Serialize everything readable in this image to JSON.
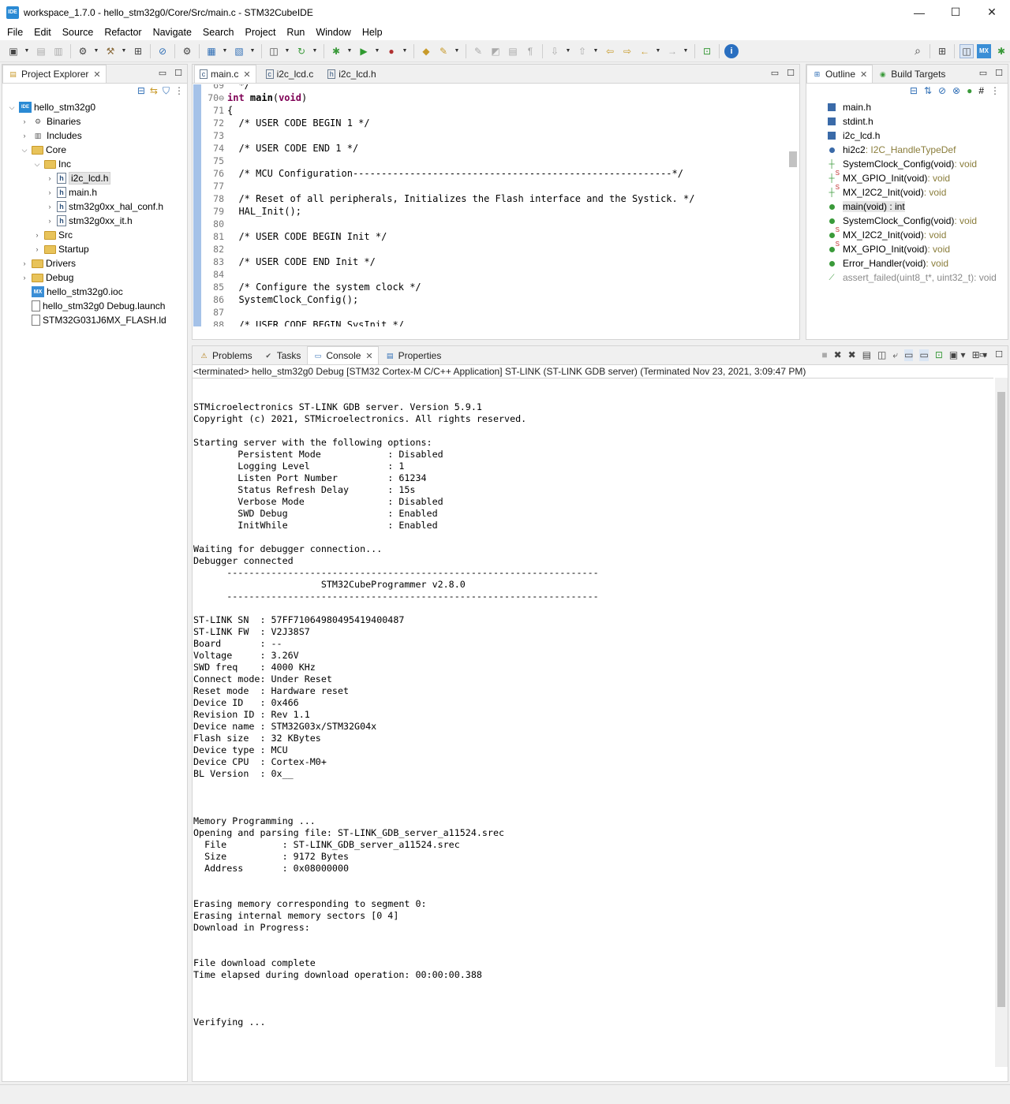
{
  "window": {
    "title": "workspace_1.7.0 - hello_stm32g0/Core/Src/main.c - STM32CubeIDE",
    "app_icon": "IDE",
    "minimize": "—",
    "maximize": "☐",
    "close": "✕"
  },
  "menu": [
    "File",
    "Edit",
    "Source",
    "Refactor",
    "Navigate",
    "Search",
    "Project",
    "Run",
    "Window",
    "Help"
  ],
  "explorer": {
    "tab_label": "Project Explorer",
    "tree": [
      {
        "label": "hello_stm32g0",
        "indent": 0,
        "arrow": "v",
        "icon": "proj"
      },
      {
        "label": "Binaries",
        "indent": 1,
        "arrow": ">",
        "icon": "bin"
      },
      {
        "label": "Includes",
        "indent": 1,
        "arrow": ">",
        "icon": "inc"
      },
      {
        "label": "Core",
        "indent": 1,
        "arrow": "v",
        "icon": "folder"
      },
      {
        "label": "Inc",
        "indent": 2,
        "arrow": "v",
        "icon": "folder"
      },
      {
        "label": "i2c_lcd.h",
        "indent": 3,
        "arrow": ">",
        "icon": "hfile",
        "selected": true
      },
      {
        "label": "main.h",
        "indent": 3,
        "arrow": ">",
        "icon": "hfile"
      },
      {
        "label": "stm32g0xx_hal_conf.h",
        "indent": 3,
        "arrow": ">",
        "icon": "hfile"
      },
      {
        "label": "stm32g0xx_it.h",
        "indent": 3,
        "arrow": ">",
        "icon": "hfile"
      },
      {
        "label": "Src",
        "indent": 2,
        "arrow": ">",
        "icon": "folder"
      },
      {
        "label": "Startup",
        "indent": 2,
        "arrow": ">",
        "icon": "folder"
      },
      {
        "label": "Drivers",
        "indent": 1,
        "arrow": ">",
        "icon": "folder"
      },
      {
        "label": "Debug",
        "indent": 1,
        "arrow": ">",
        "icon": "folder"
      },
      {
        "label": "hello_stm32g0.ioc",
        "indent": 1,
        "arrow": "",
        "icon": "mx"
      },
      {
        "label": "hello_stm32g0 Debug.launch",
        "indent": 1,
        "arrow": "",
        "icon": "file"
      },
      {
        "label": "STM32G031J6MX_FLASH.ld",
        "indent": 1,
        "arrow": "",
        "icon": "file"
      }
    ]
  },
  "editor": {
    "tabs": [
      {
        "label": "main.c",
        "active": true,
        "closable": true
      },
      {
        "label": "i2c_lcd.c",
        "active": false,
        "closable": false
      },
      {
        "label": "i2c_lcd.h",
        "active": false,
        "closable": false
      }
    ],
    "lines": [
      {
        "n": "69",
        "text": "  */",
        "cls": "cmt"
      },
      {
        "n": "70⊖",
        "text": "int main(void)",
        "cls": "fn"
      },
      {
        "n": "71",
        "text": "{",
        "cls": ""
      },
      {
        "n": "72",
        "text": "  /* USER CODE BEGIN 1 */",
        "cls": "cmt"
      },
      {
        "n": "73",
        "text": "",
        "cls": ""
      },
      {
        "n": "74",
        "text": "  /* USER CODE END 1 */",
        "cls": "cmt"
      },
      {
        "n": "75",
        "text": "",
        "cls": ""
      },
      {
        "n": "76",
        "text": "  /* MCU Configuration--------------------------------------------------------*/",
        "cls": "cmt"
      },
      {
        "n": "77",
        "text": "",
        "cls": ""
      },
      {
        "n": "78",
        "text": "  /* Reset of all peripherals, Initializes the Flash interface and the Systick. */",
        "cls": "cmt"
      },
      {
        "n": "79",
        "text": "  HAL_Init();",
        "cls": ""
      },
      {
        "n": "80",
        "text": "",
        "cls": ""
      },
      {
        "n": "81",
        "text": "  /* USER CODE BEGIN Init */",
        "cls": "cmt"
      },
      {
        "n": "82",
        "text": "",
        "cls": ""
      },
      {
        "n": "83",
        "text": "  /* USER CODE END Init */",
        "cls": "cmt"
      },
      {
        "n": "84",
        "text": "",
        "cls": ""
      },
      {
        "n": "85",
        "text": "  /* Configure the system clock */",
        "cls": "cmt"
      },
      {
        "n": "86",
        "text": "  SystemClock_Config();",
        "cls": ""
      },
      {
        "n": "87",
        "text": "",
        "cls": ""
      },
      {
        "n": "88",
        "text": "  /* USER CODE BEGIN SysInit */",
        "cls": "cmt"
      }
    ]
  },
  "outline": {
    "tabs": [
      "Outline",
      "Build Targets"
    ],
    "items": [
      {
        "name": "main.h",
        "type": "",
        "icon": "include"
      },
      {
        "name": "stdint.h",
        "type": "",
        "icon": "include"
      },
      {
        "name": "i2c_lcd.h",
        "type": "",
        "icon": "include"
      },
      {
        "name": "hi2c2",
        "type": " : I2C_HandleTypeDef",
        "icon": "var"
      },
      {
        "name": "SystemClock_Config(void)",
        "type": " : void",
        "icon": "decl"
      },
      {
        "name": "MX_GPIO_Init(void)",
        "type": " : void",
        "icon": "decl-s"
      },
      {
        "name": "MX_I2C2_Init(void)",
        "type": " : void",
        "icon": "decl-s"
      },
      {
        "name": "main(void) : int",
        "type": "",
        "icon": "fn",
        "selected": true
      },
      {
        "name": "SystemClock_Config(void)",
        "type": " : void",
        "icon": "fn"
      },
      {
        "name": "MX_I2C2_Init(void)",
        "type": " : void",
        "icon": "fn-s"
      },
      {
        "name": "MX_GPIO_Init(void)",
        "type": " : void",
        "icon": "fn-s"
      },
      {
        "name": "Error_Handler(void)",
        "type": " : void",
        "icon": "fn"
      },
      {
        "name": "assert_failed(uint8_t*, uint32_t)",
        "type": " : void",
        "icon": "inactive",
        "dim": true
      }
    ]
  },
  "console": {
    "tabs": [
      "Problems",
      "Tasks",
      "Console",
      "Properties"
    ],
    "active_tab": "Console",
    "status": "<terminated> hello_stm32g0 Debug [STM32 Cortex-M C/C++ Application] ST-LINK (ST-LINK GDB server) (Terminated Nov 23, 2021, 3:09:47 PM)",
    "output": "STMicroelectronics ST-LINK GDB server. Version 5.9.1\nCopyright (c) 2021, STMicroelectronics. All rights reserved.\n\nStarting server with the following options:\n        Persistent Mode            : Disabled\n        Logging Level              : 1\n        Listen Port Number         : 61234\n        Status Refresh Delay       : 15s\n        Verbose Mode               : Disabled\n        SWD Debug                  : Enabled\n        InitWhile                  : Enabled\n\nWaiting for debugger connection...\nDebugger connected\n      -------------------------------------------------------------------\n                       STM32CubeProgrammer v2.8.0\n      -------------------------------------------------------------------\n\nST-LINK SN  : 57FF71064980495419400487\nST-LINK FW  : V2J38S7\nBoard       : --\nVoltage     : 3.26V\nSWD freq    : 4000 KHz\nConnect mode: Under Reset\nReset mode  : Hardware reset\nDevice ID   : 0x466\nRevision ID : Rev 1.1\nDevice name : STM32G03x/STM32G04x\nFlash size  : 32 KBytes\nDevice type : MCU\nDevice CPU  : Cortex-M0+\nBL Version  : 0x__\n\n\n\nMemory Programming ...\nOpening and parsing file: ST-LINK_GDB_server_a11524.srec\n  File          : ST-LINK_GDB_server_a11524.srec\n  Size          : 9172 Bytes\n  Address       : 0x08000000\n\n\nErasing memory corresponding to segment 0:\nErasing internal memory sectors [0 4]\nDownload in Progress:\n\n\nFile download complete\nTime elapsed during download operation: 00:00:00.388\n\n\n\nVerifying ..."
  }
}
